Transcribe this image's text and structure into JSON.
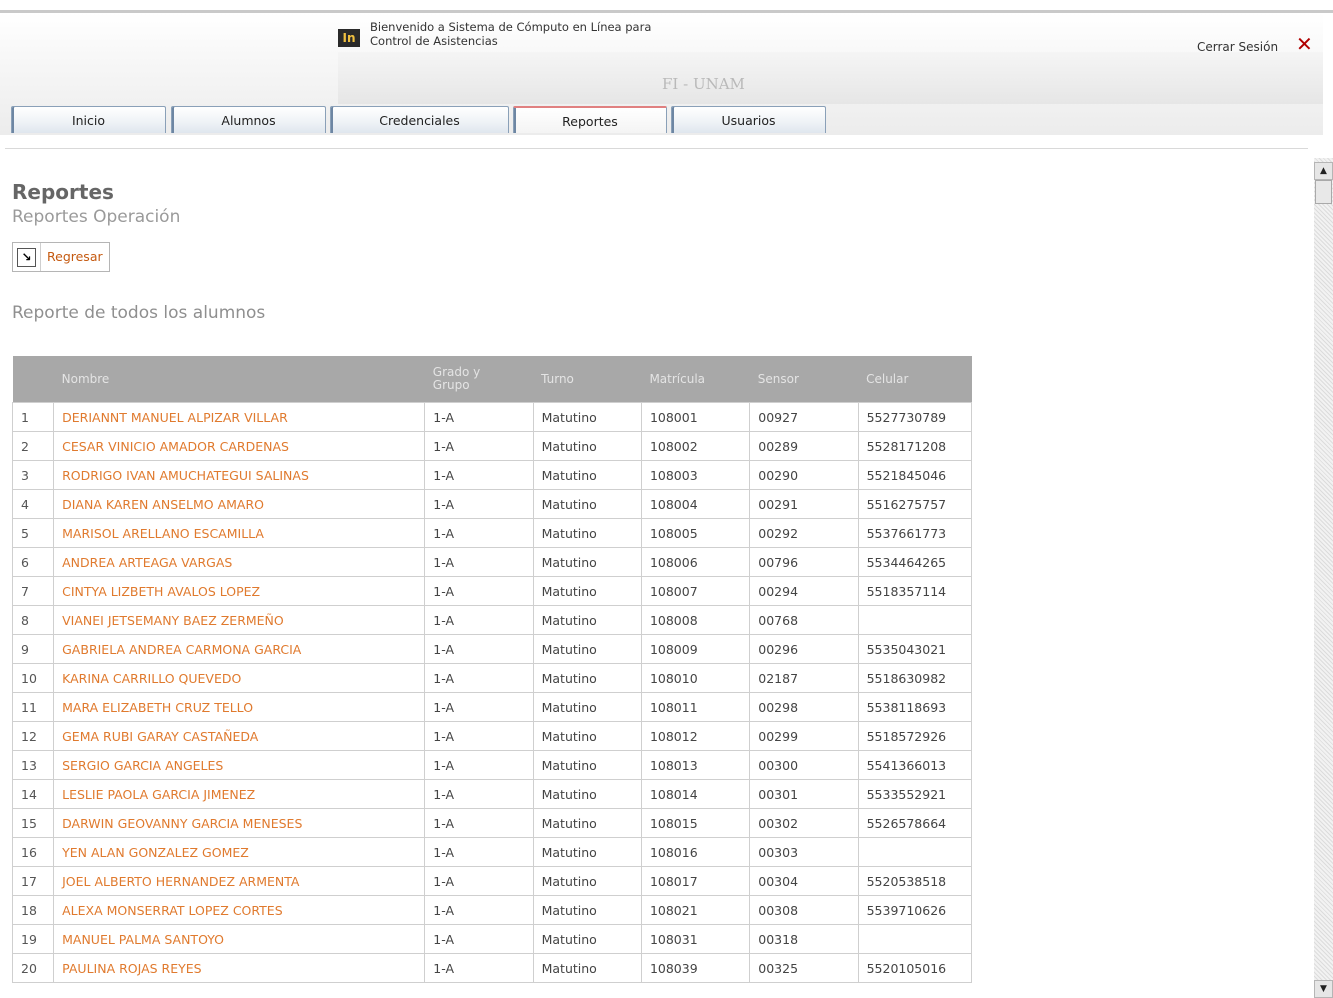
{
  "header": {
    "welcome": "Bienvenido a Sistema de Cómputo en Línea para\nControl de Asistencias",
    "org": "FI - UNAM",
    "logout_label": "Cerrar Sesión",
    "logo_text": "In"
  },
  "tabs": [
    {
      "label": "Inicio"
    },
    {
      "label": "Alumnos"
    },
    {
      "label": "Credenciales"
    },
    {
      "label": "Reportes"
    },
    {
      "label": "Usuarios"
    }
  ],
  "page": {
    "title": "Reportes",
    "subtitle": "Reportes Operación",
    "back_label": "Regresar",
    "report_title": "Reporte de todos los alumnos"
  },
  "table": {
    "headers": [
      "",
      "Nombre",
      "Grado y\nGrupo",
      "Turno",
      "Matrícula",
      "Sensor",
      "Celular"
    ],
    "rows": [
      [
        "1",
        "DERIANNT MANUEL ALPIZAR VILLAR",
        "1-A",
        "Matutino",
        "108001",
        "00927",
        "5527730789"
      ],
      [
        "2",
        "CESAR VINICIO AMADOR CARDENAS",
        "1-A",
        "Matutino",
        "108002",
        "00289",
        "5528171208"
      ],
      [
        "3",
        "RODRIGO IVAN AMUCHATEGUI SALINAS",
        "1-A",
        "Matutino",
        "108003",
        "00290",
        "5521845046"
      ],
      [
        "4",
        "DIANA KAREN ANSELMO AMARO",
        "1-A",
        "Matutino",
        "108004",
        "00291",
        "5516275757"
      ],
      [
        "5",
        "MARISOL ARELLANO ESCAMILLA",
        "1-A",
        "Matutino",
        "108005",
        "00292",
        "5537661773"
      ],
      [
        "6",
        "ANDREA ARTEAGA VARGAS",
        "1-A",
        "Matutino",
        "108006",
        "00796",
        "5534464265"
      ],
      [
        "7",
        "CINTYA LIZBETH AVALOS LOPEZ",
        "1-A",
        "Matutino",
        "108007",
        "00294",
        "5518357114"
      ],
      [
        "8",
        "VIANEI JETSEMANY BAEZ ZERMEÑO",
        "1-A",
        "Matutino",
        "108008",
        "00768",
        ""
      ],
      [
        "9",
        "GABRIELA ANDREA CARMONA GARCIA",
        "1-A",
        "Matutino",
        "108009",
        "00296",
        "5535043021"
      ],
      [
        "10",
        "KARINA CARRILLO QUEVEDO",
        "1-A",
        "Matutino",
        "108010",
        "02187",
        "5518630982"
      ],
      [
        "11",
        "MARA ELIZABETH CRUZ TELLO",
        "1-A",
        "Matutino",
        "108011",
        "00298",
        "5538118693"
      ],
      [
        "12",
        "GEMA RUBI GARAY CASTAÑEDA",
        "1-A",
        "Matutino",
        "108012",
        "00299",
        "5518572926"
      ],
      [
        "13",
        "SERGIO GARCIA ANGELES",
        "1-A",
        "Matutino",
        "108013",
        "00300",
        "5541366013"
      ],
      [
        "14",
        "LESLIE PAOLA GARCIA JIMENEZ",
        "1-A",
        "Matutino",
        "108014",
        "00301",
        "5533552921"
      ],
      [
        "15",
        "DARWIN GEOVANNY GARCIA MENESES",
        "1-A",
        "Matutino",
        "108015",
        "00302",
        "5526578664"
      ],
      [
        "16",
        "YEN ALAN GONZALEZ GOMEZ",
        "1-A",
        "Matutino",
        "108016",
        "00303",
        ""
      ],
      [
        "17",
        "JOEL ALBERTO HERNANDEZ ARMENTA",
        "1-A",
        "Matutino",
        "108017",
        "00304",
        "5520538518"
      ],
      [
        "18",
        "ALEXA MONSERRAT LOPEZ CORTES",
        "1-A",
        "Matutino",
        "108021",
        "00308",
        "5539710626"
      ],
      [
        "19",
        "MANUEL PALMA SANTOYO",
        "1-A",
        "Matutino",
        "108031",
        "00318",
        ""
      ],
      [
        "20",
        "PAULINA ROJAS REYES",
        "1-A",
        "Matutino",
        "108039",
        "00325",
        "5520105016"
      ]
    ]
  },
  "colors": {
    "accent_orange": "#e07a2e",
    "header_gray": "#a8a8a8",
    "logout_red": "#b00000"
  }
}
